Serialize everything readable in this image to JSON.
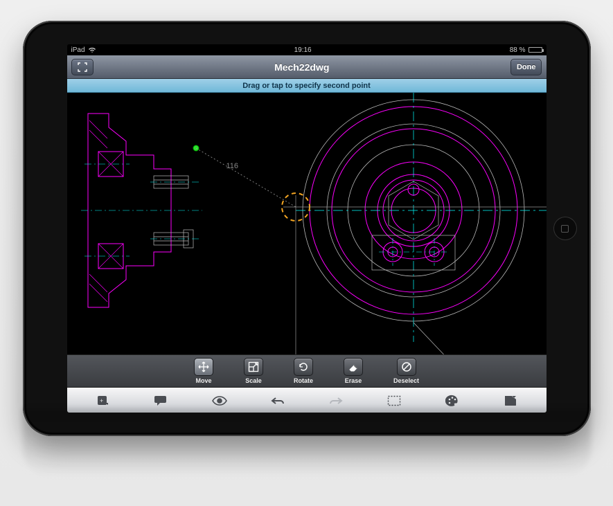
{
  "status": {
    "device": "iPad",
    "time": "19:16",
    "battery_pct": "88 %"
  },
  "nav": {
    "title": "Mech22dwg",
    "done_label": "Done"
  },
  "instruction": "Drag or tap to specify second point",
  "measurement": "116",
  "edit_tools": [
    {
      "id": "move",
      "label": "Move",
      "active": true
    },
    {
      "id": "scale",
      "label": "Scale",
      "active": false
    },
    {
      "id": "rotate",
      "label": "Rotate",
      "active": false
    },
    {
      "id": "erase",
      "label": "Erase",
      "active": false
    },
    {
      "id": "deselect",
      "label": "Deselect",
      "active": false
    }
  ],
  "bottom_icons": [
    {
      "id": "draw",
      "name": "draw-icon"
    },
    {
      "id": "annotate",
      "name": "annotate-icon"
    },
    {
      "id": "view",
      "name": "eye-icon"
    },
    {
      "id": "undo",
      "name": "undo-icon"
    },
    {
      "id": "redo",
      "name": "redo-icon"
    },
    {
      "id": "select",
      "name": "selection-icon"
    },
    {
      "id": "color",
      "name": "palette-icon"
    },
    {
      "id": "share",
      "name": "share-icon"
    }
  ],
  "colors": {
    "accent_blue": "#7fc3df",
    "cad_magenta": "#ff00ff",
    "cad_cyan": "#00ffff",
    "cad_green": "#00ff00",
    "cursor_orange": "#f5a623"
  }
}
